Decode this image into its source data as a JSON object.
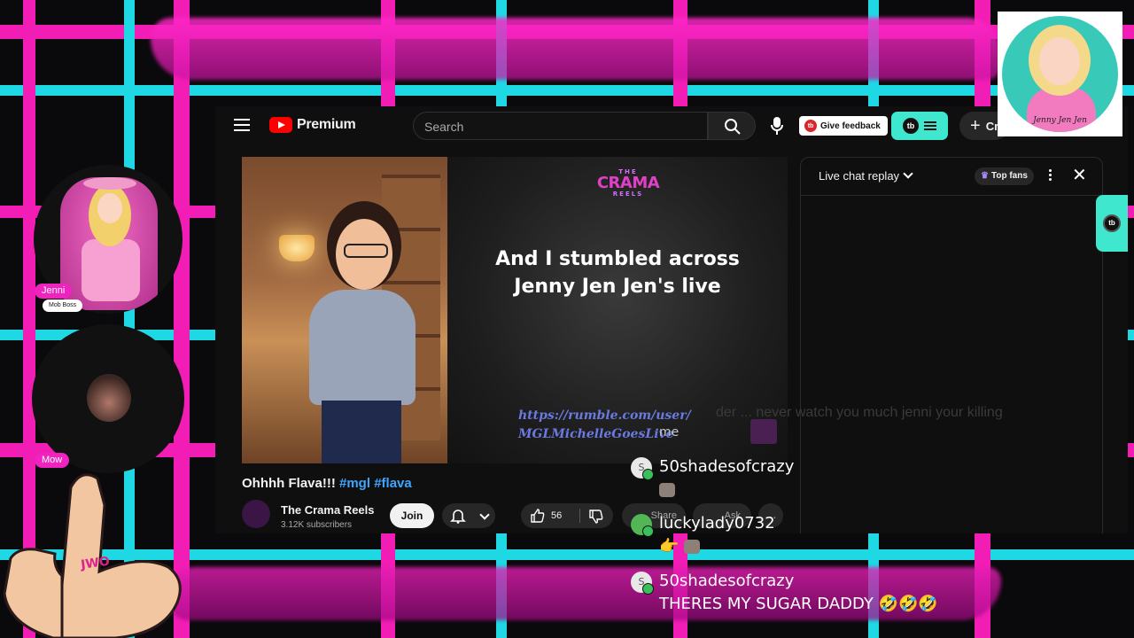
{
  "youtube": {
    "brand": "Premium",
    "search_placeholder": "Search",
    "feedback_label": "Give feedback",
    "tb_badge": "tb",
    "create_label": "Cr",
    "video": {
      "logo_small": "THE",
      "logo_main": "CRAMA",
      "logo_sub": "REELS",
      "caption": "And I stumbled across Jenny Jen Jen's live",
      "url_text": "https://rumble.com/user/ MGLMichelleGoesLive"
    },
    "title": "Ohhhh Flava!!!",
    "hashtags": [
      "#mgl",
      "#flava"
    ],
    "channel_name": "The Crama Reels",
    "subscribers": "3.12K subscribers",
    "join_label": "Join",
    "like_count": "56",
    "share_label": "Share",
    "ask_label": "Ask",
    "more_label": "…",
    "chat": {
      "title": "Live chat replay",
      "top_fans_label": "Top fans",
      "close_label": "✕",
      "ghost_text": "der ... never watch you much jenni your killing"
    }
  },
  "overlay": {
    "cam1_name": "Jenni",
    "cam1_role": "Mob Boss",
    "cam2_name": "Mow",
    "hand_text": "JWO",
    "sticker_signature": "Jenny Jen Jen"
  },
  "chat_overlay": {
    "ghost": "me",
    "messages": [
      {
        "user": "50shadesofcrazy",
        "text": "",
        "avatar": "S",
        "emotes": 1
      },
      {
        "user": "luckylady0732",
        "text": "👉",
        "avatar": "",
        "emotes": 1
      },
      {
        "user": "50shadesofcrazy",
        "text": "THERES MY SUGAR DADDY 🤣🤣🤣",
        "avatar": "S",
        "emotes": 0
      }
    ]
  },
  "colors": {
    "accent_magenta": "#ff1fbf",
    "accent_cyan": "#20e4f0",
    "tubebuddy_teal": "#3fe7cf",
    "youtube_red": "#ff0000"
  },
  "icons": [
    "hamburger-icon",
    "youtube-logo-icon",
    "search-icon",
    "mic-icon",
    "plus-icon",
    "bell-icon",
    "like-icon",
    "dislike-icon",
    "kebab-icon",
    "close-icon",
    "crown-icon"
  ]
}
